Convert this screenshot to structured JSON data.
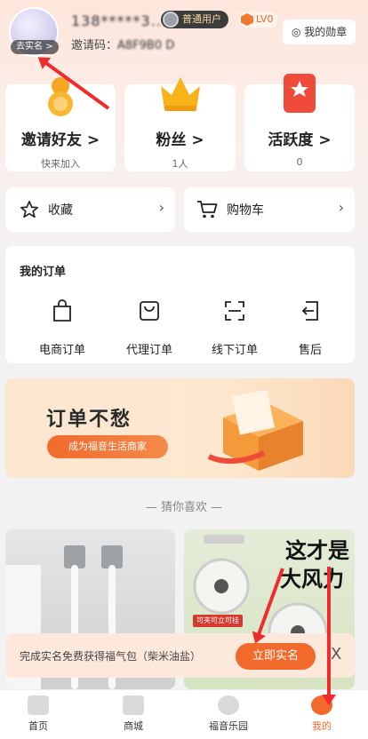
{
  "profile": {
    "realname_tag": "去实名 >",
    "username": "138*****3...",
    "badge": "普通用户",
    "level": "LV0",
    "invite_label": "邀请码：",
    "invite_code": "A8F9B0 D",
    "medal": "我的勋章"
  },
  "stats": [
    {
      "title": "邀请好友 >",
      "sub": "快来加入"
    },
    {
      "title": "粉丝 >",
      "sub": "1人"
    },
    {
      "title": "活跃度 >",
      "sub": "0"
    }
  ],
  "shortcuts": {
    "favorites": "收藏",
    "cart": "购物车"
  },
  "orders": {
    "title": "我的订单",
    "items": [
      "电商订单",
      "代理订单",
      "线下订单",
      "售后"
    ]
  },
  "banner": {
    "headline": "订单不愁",
    "button": "成为福音生活商家"
  },
  "guess": "— 猜你喜欢 —",
  "products": {
    "p2_line1": "这才是",
    "p2_line2": "大风力",
    "p2_tag": "可夹可立可挂"
  },
  "tip": {
    "text": "完成实名免费获得福气包（柴米油盐）",
    "cta": "立即实名",
    "close": "X"
  },
  "tabs": [
    "首页",
    "商城",
    "福音乐园",
    "我的"
  ],
  "colors": {
    "accent": "#f26a2b",
    "arrow": "#ef2b2b"
  }
}
